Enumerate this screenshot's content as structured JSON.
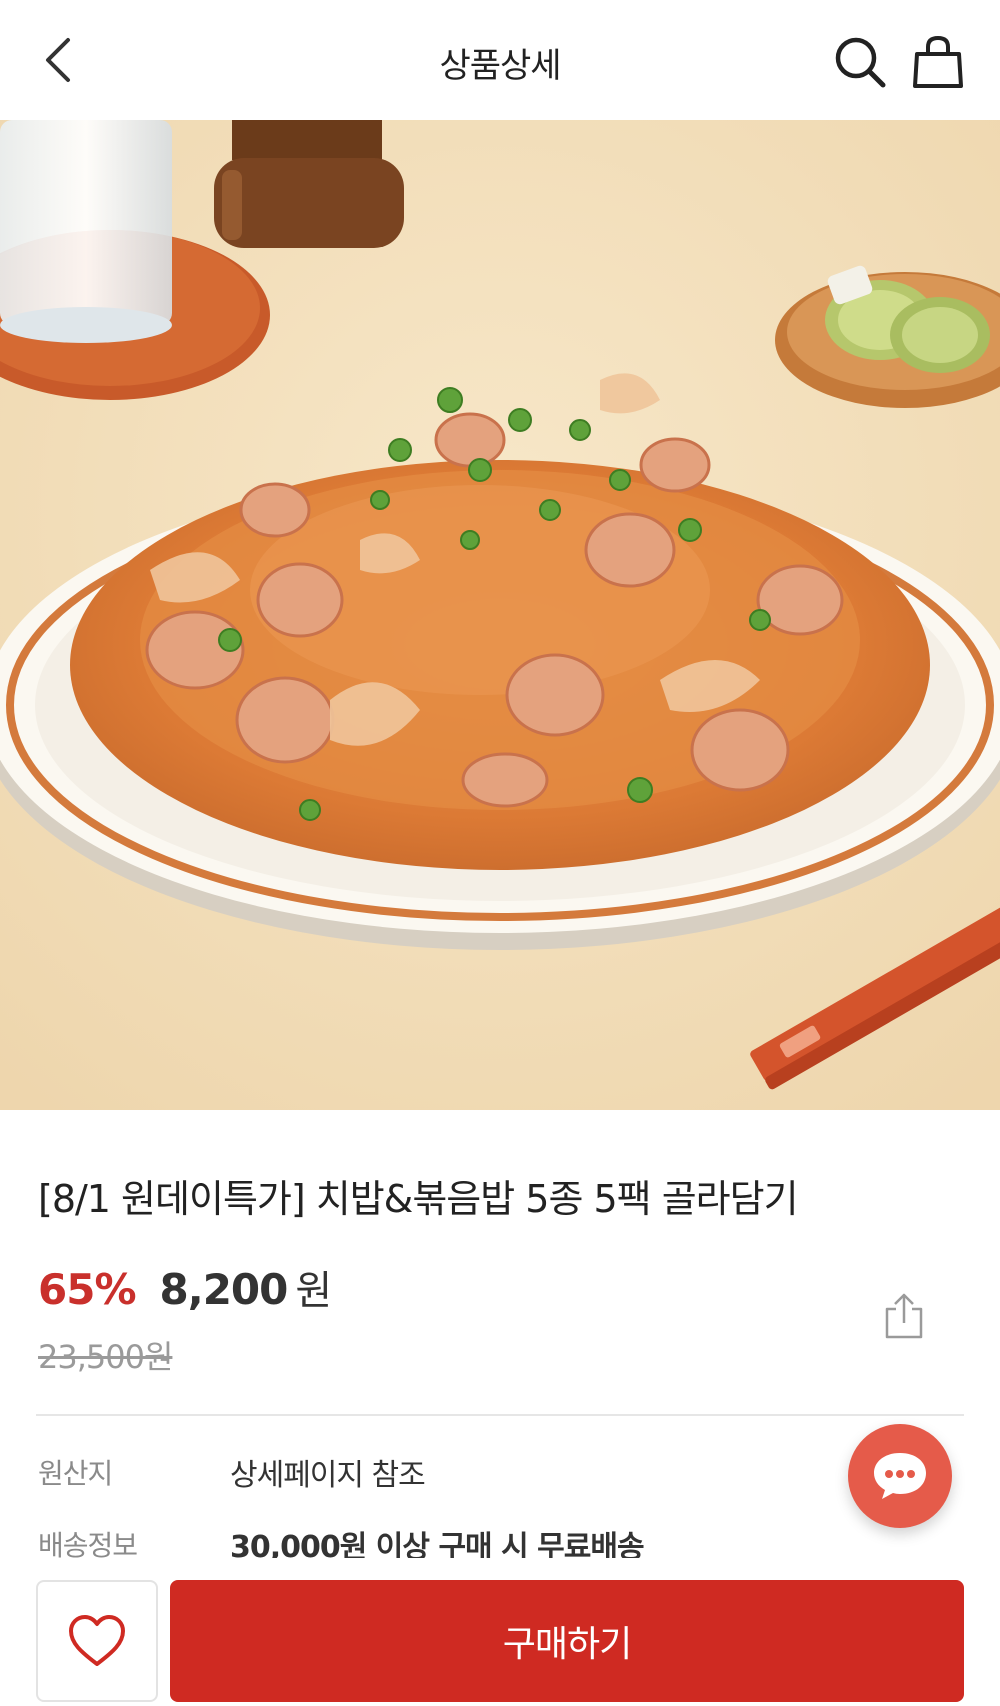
{
  "header": {
    "title": "상품상세",
    "back_icon": "chevron-left-icon",
    "search_icon": "search-icon",
    "cart_icon": "shopping-bag-icon"
  },
  "product": {
    "image_description": "kimchi fried rice with sausage slices on a white plate with orange rim",
    "title": "[8/1 원데이특가] 치밥&볶음밥 5종 5팩 골라담기",
    "discount": "65%",
    "price": "8,200",
    "currency": "원",
    "original_price": "23,500원"
  },
  "info": {
    "origin_label": "원산지",
    "origin_value": "상세페이지 참조",
    "shipping_label": "배송정보",
    "shipping_value": "30,000원 이상 구매 시 무료배송"
  },
  "actions": {
    "buy_label": "구매하기",
    "wishlist_icon": "heart-icon",
    "share_icon": "share-icon",
    "chat_icon": "chat-bubble-icon"
  },
  "colors": {
    "accent": "#cf2a22",
    "discount": "#c9302c",
    "chat": "#e55b4a"
  }
}
